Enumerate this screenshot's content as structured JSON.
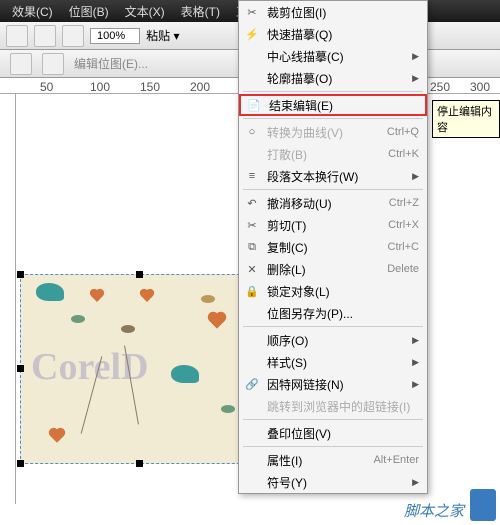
{
  "menubar": [
    "效果(C)",
    "位图(B)",
    "文本(X)",
    "表格(T)",
    "工具(Q)"
  ],
  "zoom": "100%",
  "paste": "粘贴 ▾",
  "toolbar2": {
    "edit": "编辑位图(E)..."
  },
  "ruler": {
    "r50": "50",
    "r100": "100",
    "r150": "150",
    "r200": "200",
    "r250": "250",
    "r300": "300"
  },
  "watermark": "CorelD",
  "tooltip": "停止编辑内容",
  "menu": {
    "crop": "裁剪位图(I)",
    "quick": "快速描摹(Q)",
    "center": "中心线描摹(C)",
    "outline": "轮廓描摹(O)",
    "endedit": "结束编辑(E)",
    "tocurve": "转换为曲线(V)",
    "tocurve_sc": "Ctrl+Q",
    "split": "打散(B)",
    "split_sc": "Ctrl+K",
    "para": "段落文本换行(W)",
    "undo": "撤消移动(U)",
    "undo_sc": "Ctrl+Z",
    "cut": "剪切(T)",
    "cut_sc": "Ctrl+X",
    "copy": "复制(C)",
    "copy_sc": "Ctrl+C",
    "del": "删除(L)",
    "del_sc": "Delete",
    "lock": "锁定对象(L)",
    "saveas": "位图另存为(P)...",
    "order": "顺序(O)",
    "style": "样式(S)",
    "hyperlink": "因特网链接(N)",
    "jump": "跳转到浏览器中的超链接(I)",
    "overprint": "叠印位图(V)",
    "props": "属性(I)",
    "props_sc": "Alt+Enter",
    "symbol": "符号(Y)"
  },
  "footer": "脚本之家"
}
